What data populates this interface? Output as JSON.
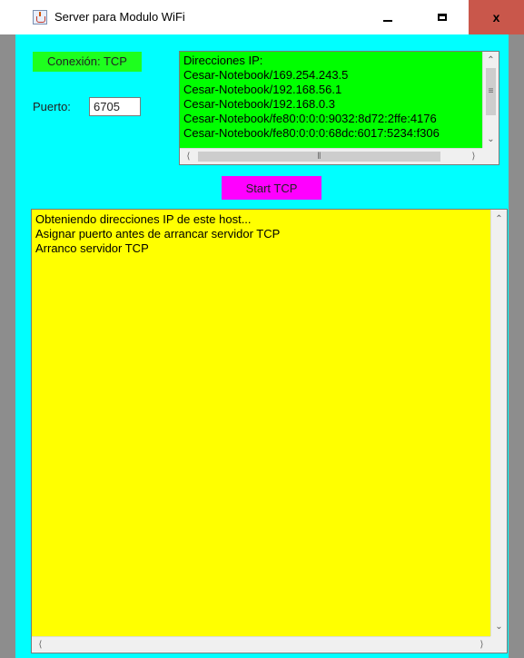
{
  "window": {
    "title": "Server para Modulo WiFi",
    "controls": {
      "minimize": "minimize-icon",
      "maximize": "maximize-icon",
      "close": "x"
    }
  },
  "connection": {
    "status_label": "Conexión: TCP"
  },
  "port": {
    "label": "Puerto:",
    "value": "6705"
  },
  "ip_panel": {
    "lines": [
      "Direcciones IP:",
      "Cesar-Notebook/169.254.243.5",
      "Cesar-Notebook/192.168.56.1",
      "Cesar-Notebook/192.168.0.3",
      "Cesar-Notebook/fe80:0:0:0:9032:8d72:2ffe:4176",
      "Cesar-Notebook/fe80:0:0:0:68dc:6017:5234:f306"
    ]
  },
  "start_button": {
    "label": "Start TCP"
  },
  "log": {
    "lines": [
      "Obteniendo direcciones IP de este host...",
      "Asignar puerto antes de arrancar servidor TCP",
      "Arranco servidor TCP"
    ]
  },
  "colors": {
    "client_bg": "#00ffff",
    "connection_label_bg": "#1eff1e",
    "ip_panel_bg": "#00ff00",
    "start_button_bg": "#ff00ff",
    "log_bg": "#ffff00",
    "close_button_bg": "#c9574b"
  }
}
